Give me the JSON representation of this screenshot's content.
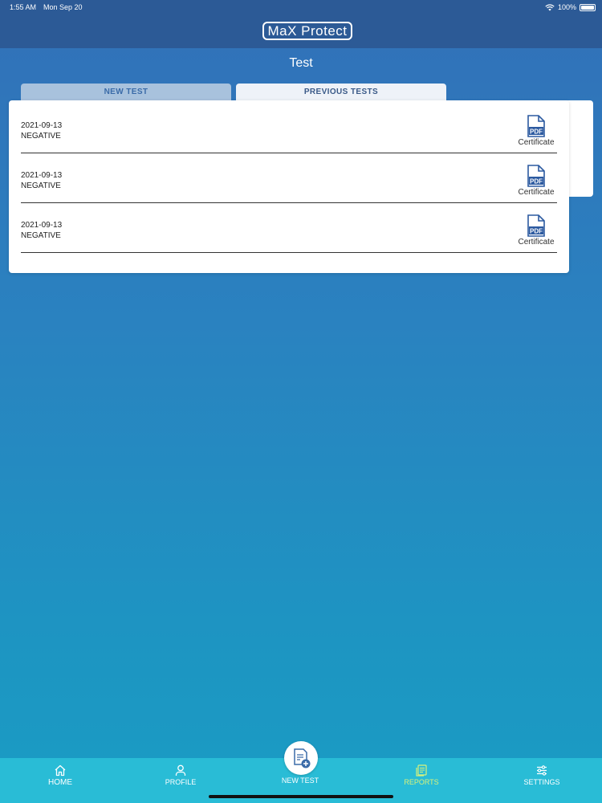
{
  "status_bar": {
    "time": "1:55 AM",
    "date": "Mon Sep 20",
    "battery": "100%"
  },
  "app": {
    "logo_text": "MaX Protect",
    "page_title": "Test"
  },
  "tabs": [
    {
      "label": "NEW TEST",
      "active": false
    },
    {
      "label": "PREVIOUS TESTS",
      "active": true
    }
  ],
  "tests": [
    {
      "date": "2021-09-13",
      "result": "NEGATIVE",
      "action_label": "Certificate",
      "icon": "pdf-icon"
    },
    {
      "date": "2021-09-13",
      "result": "NEGATIVE",
      "action_label": "Certificate",
      "icon": "pdf-icon"
    },
    {
      "date": "2021-09-13",
      "result": "NEGATIVE",
      "action_label": "Certificate",
      "icon": "pdf-icon"
    }
  ],
  "bottom_nav": {
    "home": {
      "label": "HOME",
      "icon": "home-icon"
    },
    "profile": {
      "label": "PROFILE",
      "icon": "person-icon"
    },
    "new_test": {
      "label": "NEW TEST",
      "icon": "document-add-icon"
    },
    "reports": {
      "label": "REPORTS",
      "icon": "reports-icon",
      "active": true
    },
    "settings": {
      "label": "SETTINGS",
      "icon": "sliders-icon"
    }
  },
  "colors": {
    "header": "#2c5a96",
    "nav_bar": "#29bcd6",
    "active_nav": "#d9f27a",
    "pdf_blue": "#2c5aa0"
  }
}
